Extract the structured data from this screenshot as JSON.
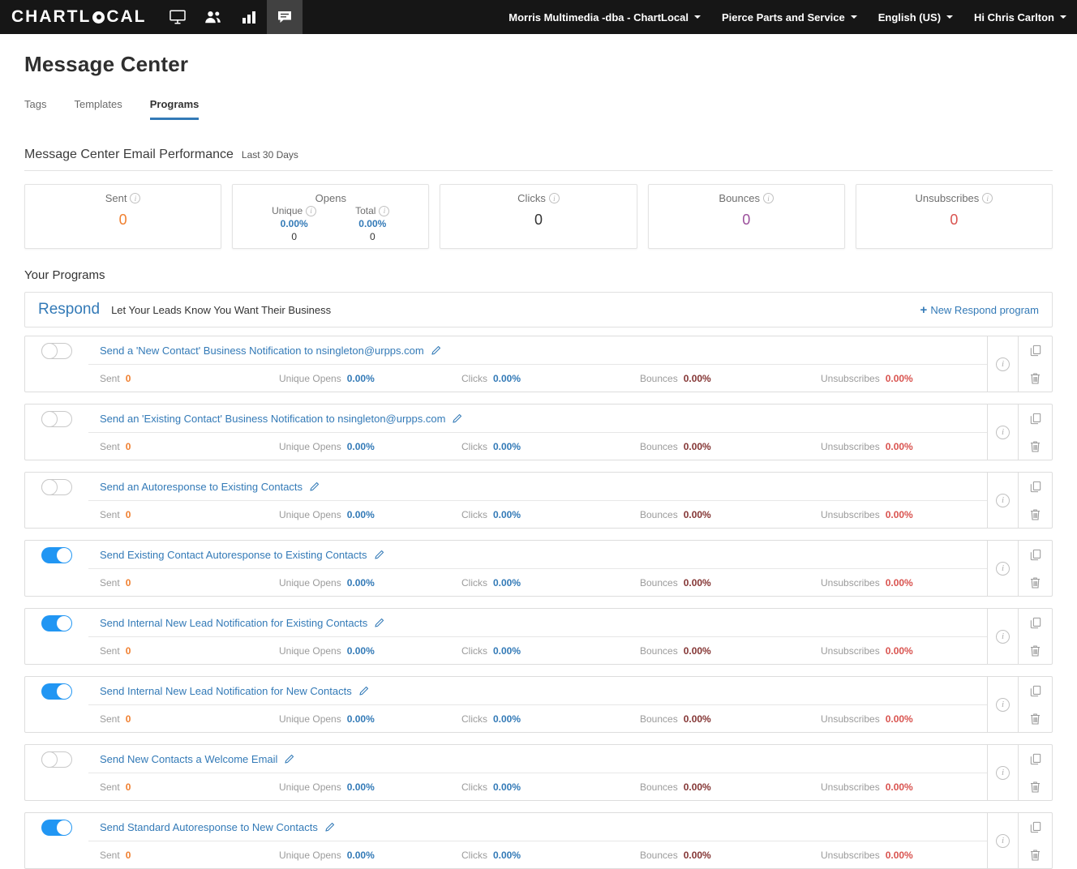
{
  "navbar": {
    "logo_left": "CHARTL",
    "logo_right": "CAL",
    "icons": [
      "desktop-icon",
      "users-icon",
      "bar-chart-icon",
      "messages-icon"
    ],
    "menus": {
      "company": "Morris Multimedia -dba - ChartLocal",
      "location": "Pierce Parts and Service",
      "language": "English (US)",
      "user": "Hi Chris Carlton"
    }
  },
  "page_title": "Message Center",
  "tabs": [
    {
      "label": "Tags"
    },
    {
      "label": "Templates"
    },
    {
      "label": "Programs"
    }
  ],
  "performance": {
    "heading": "Message Center Email Performance",
    "period": "Last 30 Days",
    "cards": {
      "sent": {
        "label": "Sent",
        "value": "0"
      },
      "opens": {
        "label": "Opens",
        "unique_label": "Unique",
        "unique_pct": "0.00%",
        "unique_count": "0",
        "total_label": "Total",
        "total_pct": "0.00%",
        "total_count": "0"
      },
      "clicks": {
        "label": "Clicks",
        "value": "0"
      },
      "bounces": {
        "label": "Bounces",
        "value": "0"
      },
      "unsubscribes": {
        "label": "Unsubscribes",
        "value": "0"
      }
    }
  },
  "your_programs": {
    "heading": "Your Programs",
    "respond_title": "Respond",
    "respond_subtitle": "Let Your Leads Know You Want Their Business",
    "new_program_label": "New Respond program"
  },
  "stats_labels": {
    "sent": "Sent",
    "unique_opens": "Unique Opens",
    "clicks": "Clicks",
    "bounces": "Bounces",
    "unsubscribes": "Unsubscribes"
  },
  "programs": [
    {
      "title": "Send a 'New Contact' Business Notification to nsingleton@urpps.com",
      "enabled": false,
      "sent": "0",
      "unique_opens": "0.00%",
      "clicks": "0.00%",
      "bounces": "0.00%",
      "unsubscribes": "0.00%"
    },
    {
      "title": "Send an 'Existing Contact' Business Notification to nsingleton@urpps.com",
      "enabled": false,
      "sent": "0",
      "unique_opens": "0.00%",
      "clicks": "0.00%",
      "bounces": "0.00%",
      "unsubscribes": "0.00%"
    },
    {
      "title": "Send an Autoresponse to Existing Contacts",
      "enabled": false,
      "sent": "0",
      "unique_opens": "0.00%",
      "clicks": "0.00%",
      "bounces": "0.00%",
      "unsubscribes": "0.00%"
    },
    {
      "title": "Send Existing Contact Autoresponse to Existing Contacts",
      "enabled": true,
      "sent": "0",
      "unique_opens": "0.00%",
      "clicks": "0.00%",
      "bounces": "0.00%",
      "unsubscribes": "0.00%"
    },
    {
      "title": "Send Internal New Lead Notification for Existing Contacts",
      "enabled": true,
      "sent": "0",
      "unique_opens": "0.00%",
      "clicks": "0.00%",
      "bounces": "0.00%",
      "unsubscribes": "0.00%"
    },
    {
      "title": "Send Internal New Lead Notification for New Contacts",
      "enabled": true,
      "sent": "0",
      "unique_opens": "0.00%",
      "clicks": "0.00%",
      "bounces": "0.00%",
      "unsubscribes": "0.00%"
    },
    {
      "title": "Send New Contacts a Welcome Email",
      "enabled": false,
      "sent": "0",
      "unique_opens": "0.00%",
      "clicks": "0.00%",
      "bounces": "0.00%",
      "unsubscribes": "0.00%"
    },
    {
      "title": "Send Standard Autoresponse to New Contacts",
      "enabled": true,
      "sent": "0",
      "unique_opens": "0.00%",
      "clicks": "0.00%",
      "bounces": "0.00%",
      "unsubscribes": "0.00%"
    }
  ],
  "colors": {
    "accent_blue": "#337ab7",
    "toggle_on_blue": "#2196f3",
    "sent_orange": "#f07f2f",
    "bounces_purple": "#9b4f9b",
    "bounces_row_maroon": "#843534",
    "unsubscribes_red": "#d9534f",
    "navbar_black": "#161616"
  }
}
